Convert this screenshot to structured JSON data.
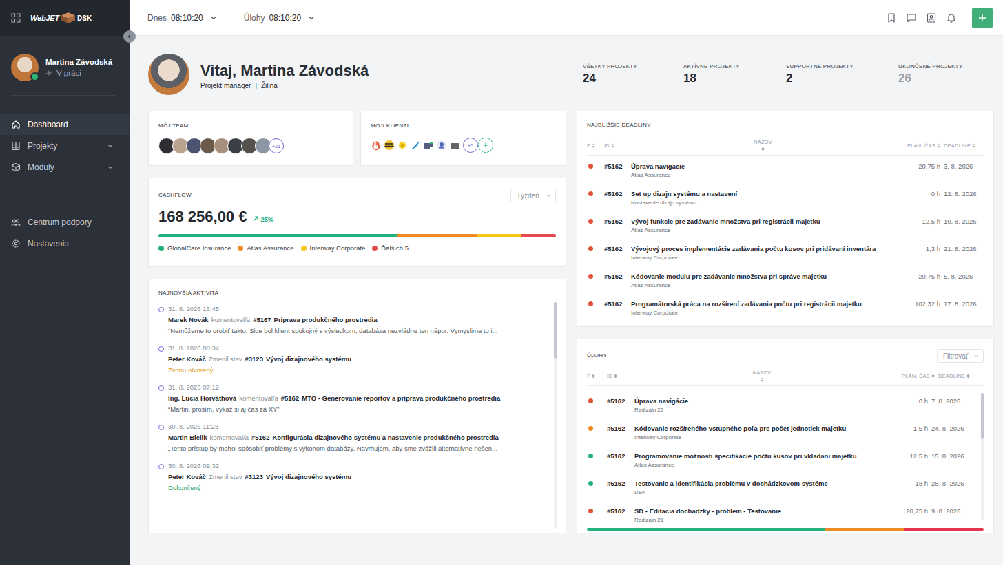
{
  "sidebar": {
    "logo": {
      "product": "WebJET",
      "brand": "DSK"
    },
    "user": {
      "name": "Martina Závodská",
      "status": "V práci",
      "online": true
    },
    "nav_main": [
      {
        "label": "Dashboard",
        "selected": true,
        "expandable": false,
        "expanded": false
      },
      {
        "label": "Projekty",
        "selected": false,
        "expandable": true,
        "expanded": false
      },
      {
        "label": "Moduly",
        "selected": false,
        "expandable": true,
        "expanded": false
      }
    ],
    "nav_support": [
      {
        "label": "Centrum podpory",
        "selected": false
      },
      {
        "label": "Nastavenia",
        "selected": false
      }
    ]
  },
  "topbar": {
    "timers": [
      {
        "label": "Dnes",
        "value": "08:10:20"
      },
      {
        "label": "Úlohy",
        "value": "08:10:20"
      }
    ]
  },
  "header": {
    "greeting": "Vitaj, Martina Závodská",
    "role": "Projekt manager",
    "separator": "|",
    "city": "Žilina"
  },
  "stats": [
    {
      "label": "VŠETKY PROJEKTY",
      "value": "24",
      "muted": false
    },
    {
      "label": "AKTÍVNE PROJEKTY",
      "value": "18",
      "muted": false
    },
    {
      "label": "SUPPORTNÉ PROJEKTY",
      "value": "2",
      "muted": false
    },
    {
      "label": "UKONČENÉ PROJEKTY",
      "value": "26",
      "muted": true
    }
  ],
  "team": {
    "title": "MÔJ TEAM",
    "more": "+21"
  },
  "clients": {
    "title": "MOJI KLIENTI",
    "more": "+5"
  },
  "cashflow": {
    "title": "CASHFLOW",
    "period": "Týždeň",
    "amount": "168 256,00 €",
    "trend": "25%",
    "segments": [
      {
        "label": "GlobalCare Insurance",
        "level": 0.6,
        "color": "#22b07d"
      },
      {
        "label": "Atlas Assurance",
        "level": 0.2,
        "color": "#f08a24"
      },
      {
        "label": "Interway Corporate",
        "level": 0.113,
        "color": "#f5c518"
      },
      {
        "label": "Ďalších 5",
        "level": 0.087,
        "color": "#e5484d"
      }
    ]
  },
  "activity": {
    "title": "NAJNOVŠIA AKTIVITA",
    "scrollbar": {
      "level": 0.25
    },
    "items": [
      {
        "date": "31. 8. 2026 16:45",
        "author": "Marek Novák",
        "action": "komentoval/a",
        "task_id": "#5167",
        "task_title": "Príprava produkčného prostredia",
        "kind": "comment",
        "text": "“Nemôžeme to urobiť takto. Sice bol klient spokojný s výsledkom, databáza nezvládne ten nápor. Vymyslime to i...",
        "color": "#555a62"
      },
      {
        "date": "31. 8. 2026 08:34",
        "author": "Peter Kováč",
        "action": "Zmenil stav",
        "task_id": "#3123",
        "task_title": "Vývoj dizajnového systému",
        "kind": "status",
        "text": "Zvonu otvorený",
        "color": "#e39a12"
      },
      {
        "date": "31. 8. 2026 07:12",
        "author": "Ing. Lucia Horváthová",
        "action": "komentoval/a",
        "task_id": "#5162",
        "task_title": "MTO - Generovanie reportov a príprava produkčného prostredia",
        "kind": "comment",
        "text": "“Martin, prosím, vykáž si aj čas za XY”",
        "color": "#555a62"
      },
      {
        "date": "30. 8. 2026 11:23",
        "author": "Martin Bielik",
        "action": "komentoval/a",
        "task_id": "#5162",
        "task_title": "Konfigurácia dizajnového systému a nastavenie produkčného prostredia",
        "kind": "comment",
        "text": "„Tento prístup by mohol spôsobiť problémy s výkonom databázy. Navrhujem, aby sme zvážili alternatívne riešen...",
        "color": "#555a62"
      },
      {
        "date": "30. 8. 2026 09:32",
        "author": "Peter Kováč",
        "action": "Zmenil stav",
        "task_id": "#3123",
        "task_title": "Vývoj dizajnového systému",
        "kind": "status",
        "text": "Dokončený",
        "color": "#2aa876"
      }
    ]
  },
  "deadlines": {
    "title": "NAJBLIŽŠIE DEADLINY",
    "columns": [
      "P",
      "ID",
      "NÁZOV",
      "PLÁN. ČAS",
      "DEADLINE"
    ],
    "rows": [
      {
        "color": "#e0533a",
        "id": "#5162",
        "title": "Úprava navigácie",
        "subtitle": "Atlas Assurance",
        "time": "20,75 h",
        "deadline": "3. 8. 2026"
      },
      {
        "color": "#e0533a",
        "id": "#5162",
        "title": "Set up dizajn systému a nastavení",
        "subtitle": "Nastavenie dizajn systému",
        "time": "0 h",
        "deadline": "12. 8. 2026"
      },
      {
        "color": "#e0533a",
        "id": "#5162",
        "title": "Vývoj funkcie pre zadávanie množstva pri registrácii majetku",
        "subtitle": "Atlas Assurance",
        "time": "12,5 h",
        "deadline": "19. 8. 2026"
      },
      {
        "color": "#e0533a",
        "id": "#5162",
        "title": "Vývojový proces implementácie zadávania počtu kusov pri pridávaní inventára",
        "subtitle": "Interway Corporate",
        "time": "1,3 h",
        "deadline": "21. 8. 2026"
      },
      {
        "color": "#e0533a",
        "id": "#5162",
        "title": "Kódovanie modulu pre zadávanie množstva pri správe majetku",
        "subtitle": "Atlas Assurance",
        "time": "20,75 h",
        "deadline": "5. 8. 2026"
      },
      {
        "color": "#e0533a",
        "id": "#5162",
        "title": "Programátorská práca na rozšírení zadávania počtu pri registrácii majetku",
        "subtitle": "Interway Corporate",
        "time": "102,32 h",
        "deadline": "17. 8. 2026"
      }
    ]
  },
  "tasks": {
    "title": "ÚLOHY",
    "filter": "Filtrovať",
    "columns": [
      "P",
      "ID",
      "NÁZOV",
      "PLÁN. ČAS",
      "DEADLINE"
    ],
    "scrollbar": {
      "level": 0.36
    },
    "rows": [
      {
        "color": "#e0533a",
        "id": "#5162",
        "title": "Úprava navigácie",
        "subtitle": "Redizajn 22",
        "time": "0 h",
        "deadline": "7. 8. 2026"
      },
      {
        "color": "#f08a24",
        "id": "#5162",
        "title": "Kódovanie rozšíreného vstupného poľa pre počet jednotiek majetku",
        "subtitle": "Interway Corporate",
        "time": "1,5 h",
        "deadline": "24. 8. 2026"
      },
      {
        "color": "#22b07d",
        "id": "#5162",
        "title": "Programovanie možnosti špecifikácie počtu kusov pri vkladaní majetku",
        "subtitle": "Atlas Assurance",
        "time": "12,5 h",
        "deadline": "15. 8. 2026"
      },
      {
        "color": "#22b07d",
        "id": "#5162",
        "title": "Testovanie a identifikácia problému v dochádzkovom systéme",
        "subtitle": "DSK",
        "time": "18 h",
        "deadline": "28. 8. 2026"
      },
      {
        "color": "#e0533a",
        "id": "#5162",
        "title": "SD - Editacia dochadzky - problem - Testovanie",
        "subtitle": "Redizajn 21",
        "time": "20,75 h",
        "deadline": "9. 8. 2026"
      }
    ],
    "progress": [
      {
        "level": 0.6,
        "color": "#22b07d"
      },
      {
        "level": 0.2,
        "color": "#f08a24"
      },
      {
        "level": 0.2,
        "color": "#e5364f"
      }
    ]
  }
}
